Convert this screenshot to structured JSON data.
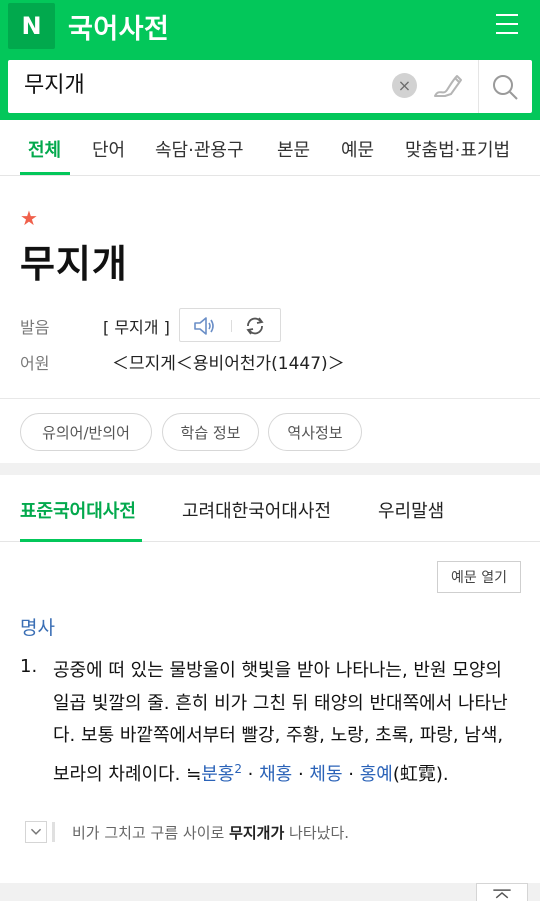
{
  "header": {
    "logo": "N",
    "brand": "국어사전",
    "search_value": "무지개",
    "clear_glyph": "×",
    "icons": [
      "menu-icon",
      "handwriting-icon",
      "search-icon"
    ]
  },
  "tabs": [
    {
      "label": "전체",
      "active": true
    },
    {
      "label": "단어"
    },
    {
      "label": "속담·관용구"
    },
    {
      "label": "본문"
    },
    {
      "label": "예문"
    },
    {
      "label": "맞춤법·표기법"
    }
  ],
  "entry": {
    "star": "★",
    "title": "무지개",
    "pron_label": "발음",
    "pron_value": "[ 무지개 ]",
    "etym_label": "어원",
    "etym_value": "＜므지게＜용비어천가(1447)＞"
  },
  "chips": [
    "유의어/반의어",
    "학습 정보",
    "역사정보"
  ],
  "dict_tabs": [
    {
      "label": "표준국어대사전",
      "active": true
    },
    {
      "label": "고려대한국어대사전"
    },
    {
      "label": "우리말샘"
    }
  ],
  "example_toggle": "예문 열기",
  "pos": "명사",
  "definition": {
    "num": "1.",
    "text": "공중에 떠 있는 물방울이 햇빛을 받아 나타나는, 반원 모양의 일곱 빛깔의 줄. 흔히 비가 그친 뒤 태양의 반대쪽에서 나타난다. 보통 바깥쪽에서부터 빨강, 주황, 노랑, 초록, 파랑, 남색, 보라의 차례이다. ≒",
    "synonyms": [
      {
        "word": "분홍",
        "sup": "2"
      },
      {
        "word": "채홍"
      },
      {
        "word": "체동"
      },
      {
        "word": "홍예"
      }
    ],
    "separator": " · ",
    "hanja": "(虹霓)."
  },
  "example": {
    "before": "비가 그치고 구름 사이로 ",
    "highlight": "무지개가",
    "after": " 나타났다."
  }
}
